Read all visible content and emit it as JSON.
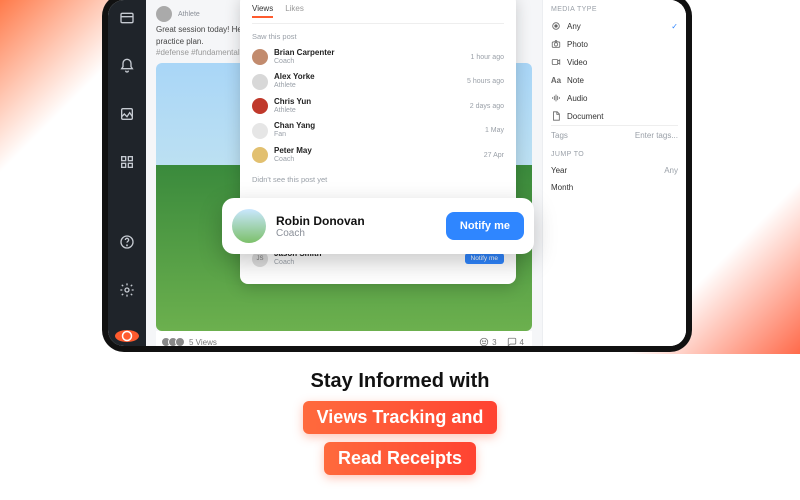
{
  "post": {
    "author_role": "Athlete",
    "text": "Great session today! Here's a...",
    "truncate_suffix": "practice plan.",
    "hashtags": "#defense #fundamentals #b",
    "views_label": "5 Views",
    "comments_count": "3",
    "msgs_count": "4"
  },
  "popover": {
    "tabs": {
      "views": "Views",
      "likes": "Likes"
    },
    "saw_label": "Saw this post",
    "saw": [
      {
        "name": "Brian Carpenter",
        "role": "Coach",
        "ago": "1 hour ago",
        "avcolor": "#c28b6e"
      },
      {
        "name": "Alex Yorke",
        "role": "Athlete",
        "ago": "5 hours ago",
        "avcolor": "#d8d8d8"
      },
      {
        "name": "Chris Yun",
        "role": "Athlete",
        "ago": "2 days ago",
        "avcolor": "#c0392b"
      },
      {
        "name": "Chan Yang",
        "role": "Fan",
        "ago": "1 May",
        "avcolor": "#e6e6e6"
      },
      {
        "name": "Peter May",
        "role": "Coach",
        "ago": "27 Apr",
        "avcolor": "#e2c070"
      }
    ],
    "notseen_label": "Didn't see this post yet",
    "notify_label": "Notify me",
    "jason": {
      "name": "Jason Smith",
      "role": "Coach"
    }
  },
  "highlight": {
    "name": "Robin Donovan",
    "role": "Coach",
    "btn": "Notify me"
  },
  "rightcol": {
    "media_head": "MEDIA TYPE",
    "items": [
      {
        "label": "Any",
        "icon": "circle-dot",
        "selected": true
      },
      {
        "label": "Photo",
        "icon": "camera"
      },
      {
        "label": "Video",
        "icon": "video"
      },
      {
        "label": "Note",
        "icon": "text"
      },
      {
        "label": "Audio",
        "icon": "audio"
      },
      {
        "label": "Document",
        "icon": "doc"
      }
    ],
    "tags_label": "Tags",
    "tags_placeholder": "Enter tags...",
    "jump_head": "JUMP TO",
    "year_label": "Year",
    "year_val": "Any",
    "month_label": "Month"
  },
  "marketing": {
    "line1": "Stay Informed with",
    "pill1": "Views Tracking and",
    "pill2": "Read Receipts"
  }
}
